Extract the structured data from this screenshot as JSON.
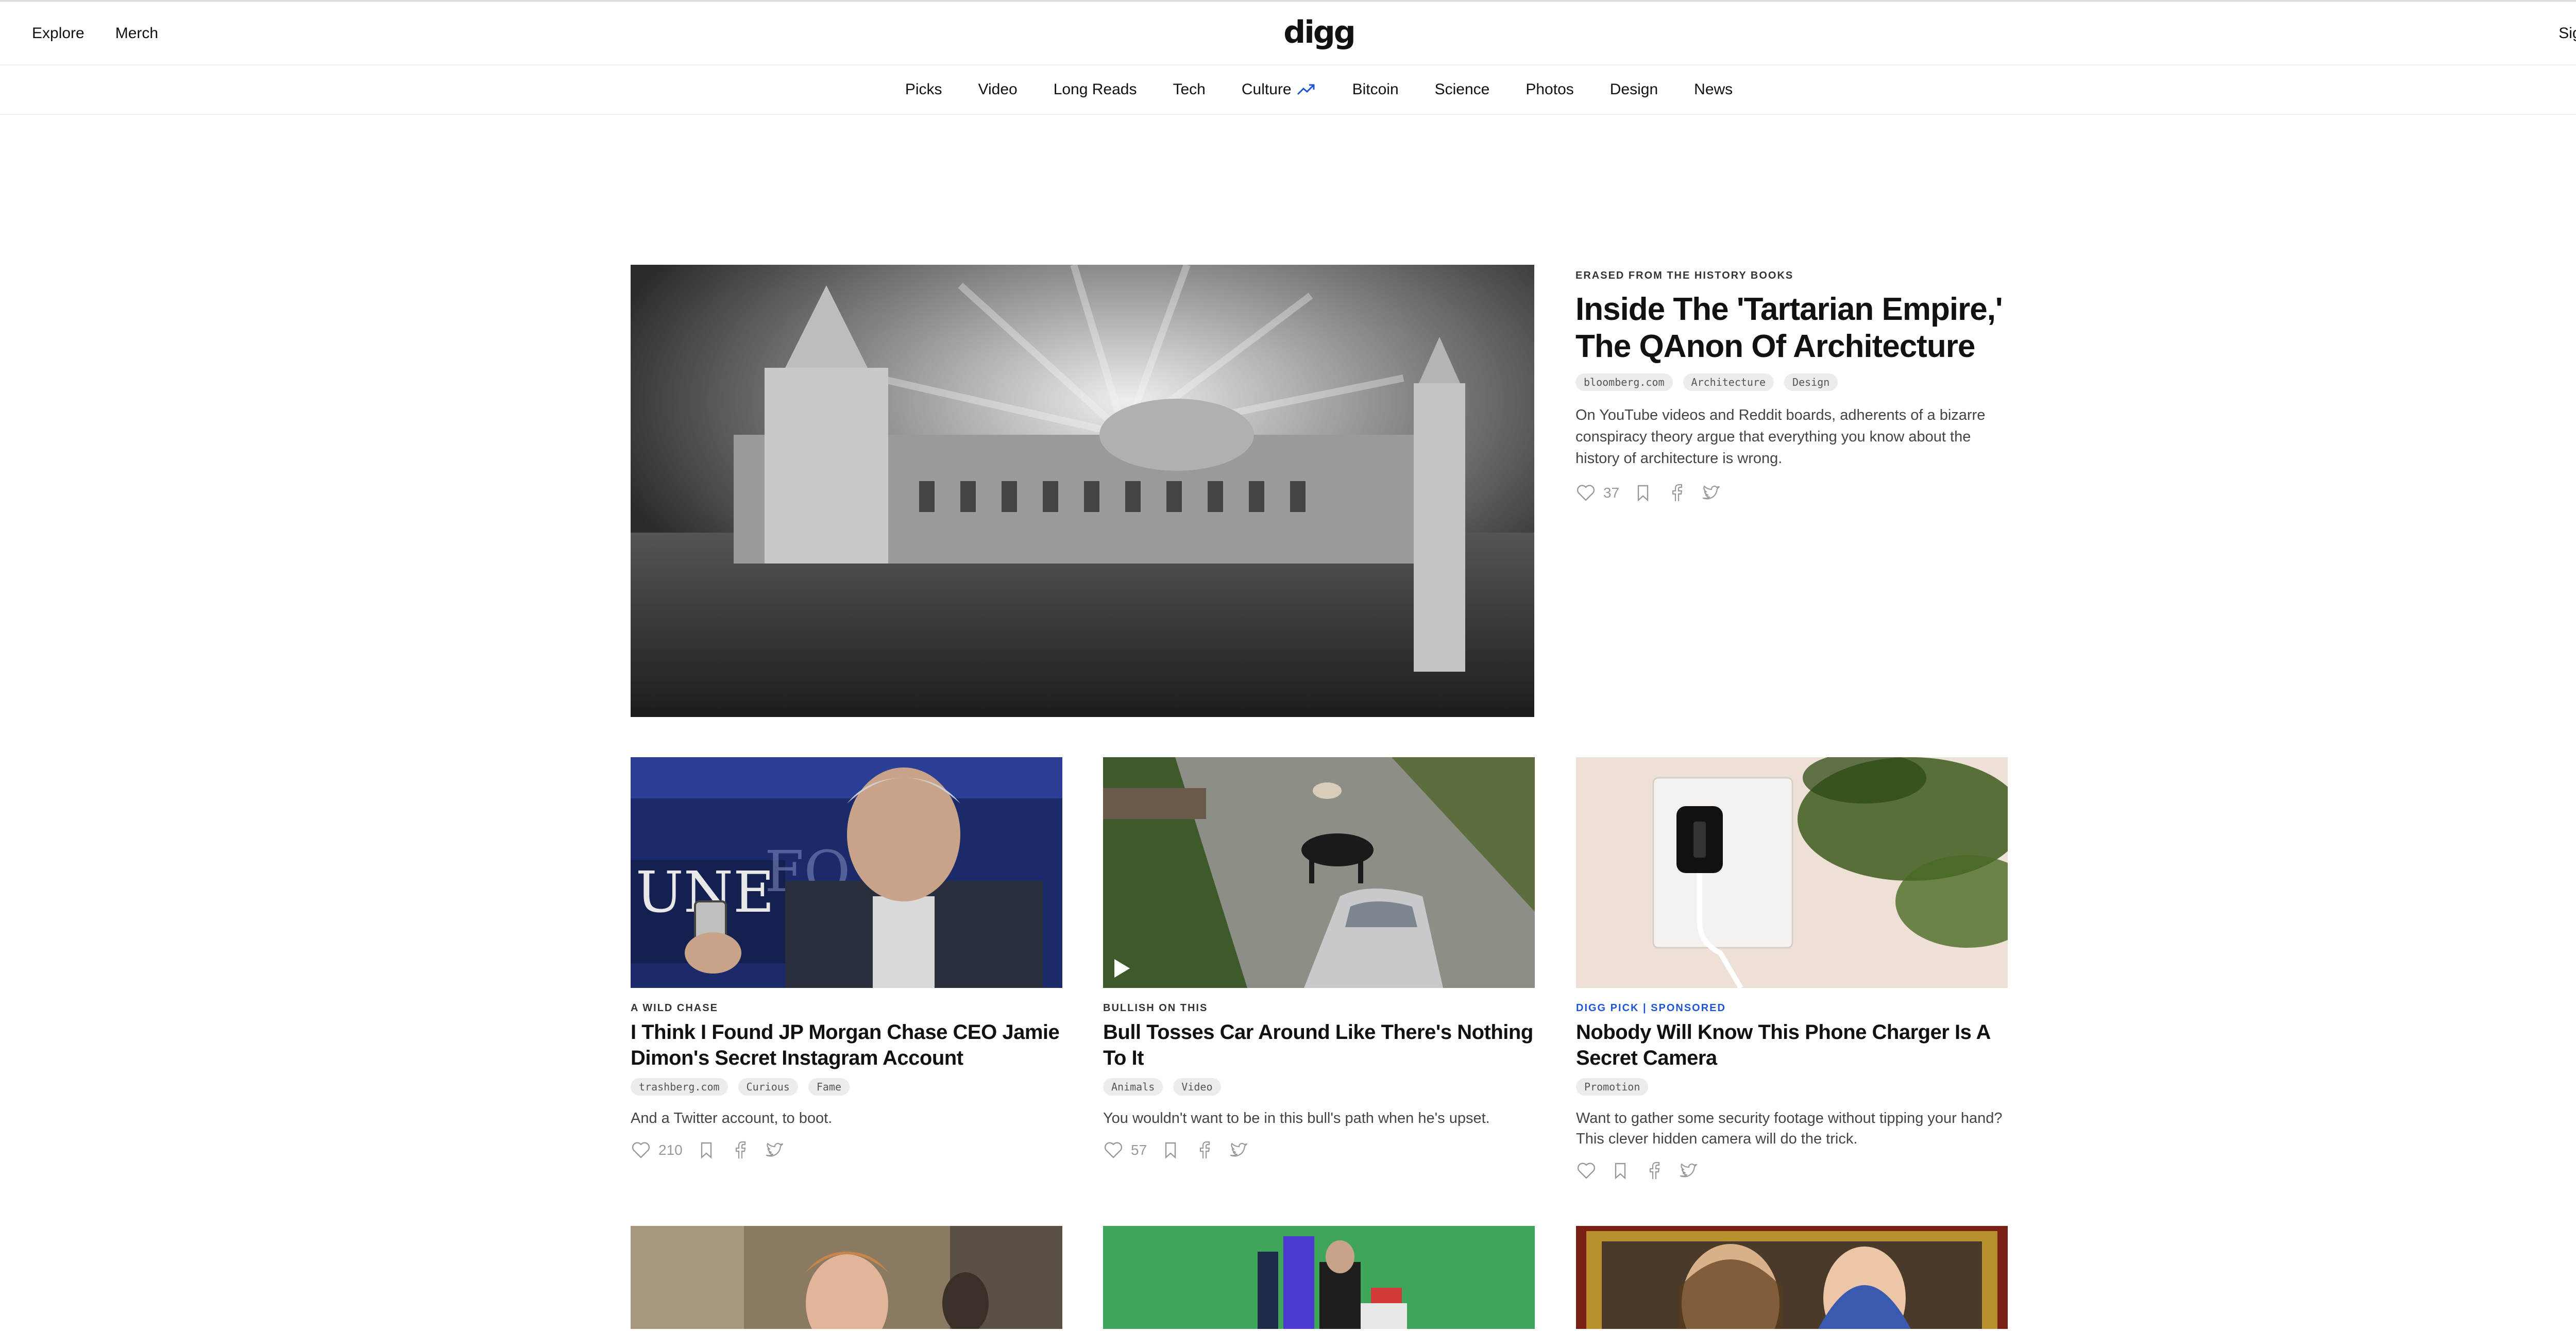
{
  "header": {
    "explore": "Explore",
    "merch": "Merch",
    "logo": "digg",
    "signin": "Sign in"
  },
  "nav": [
    "Picks",
    "Video",
    "Long Reads",
    "Tech",
    "Culture",
    "Bitcoin",
    "Science",
    "Photos",
    "Design",
    "News"
  ],
  "featured": {
    "kicker": "ERASED FROM THE HISTORY BOOKS",
    "title": "Inside The 'Tartarian Empire,' The QAnon Of Architecture",
    "tags": [
      "bloomberg.com",
      "Architecture",
      "Design"
    ],
    "description": "On YouTube videos and Reddit boards, adherents of a bizarre conspiracy theory argue that everything you know about the history of architecture is wrong.",
    "likes": "37"
  },
  "cards": [
    {
      "kicker": "A WILD CHASE",
      "title": "I Think I Found JP Morgan Chase CEO Jamie Dimon's Secret Instagram Account",
      "tags": [
        "trashberg.com",
        "Curious",
        "Fame"
      ],
      "description": "And a Twitter account, to boot.",
      "likes": "210"
    },
    {
      "kicker": "BULLISH ON THIS",
      "title": "Bull Tosses Car Around Like There's Nothing To It",
      "tags": [
        "Animals",
        "Video"
      ],
      "description": "You wouldn't want to be in this bull's path when he's upset.",
      "likes": "57"
    },
    {
      "kicker": "DIGG PICK | SPONSORED",
      "title": "Nobody Will Know This Phone Charger Is A Secret Camera",
      "tags": [
        "Promotion"
      ],
      "description": "Want to gather some security footage without tipping your hand? This clever hidden camera will do the trick.",
      "likes": ""
    }
  ],
  "colors": {
    "accent_blue": "#1e55d6",
    "text": "#111111",
    "muted": "#444444"
  }
}
